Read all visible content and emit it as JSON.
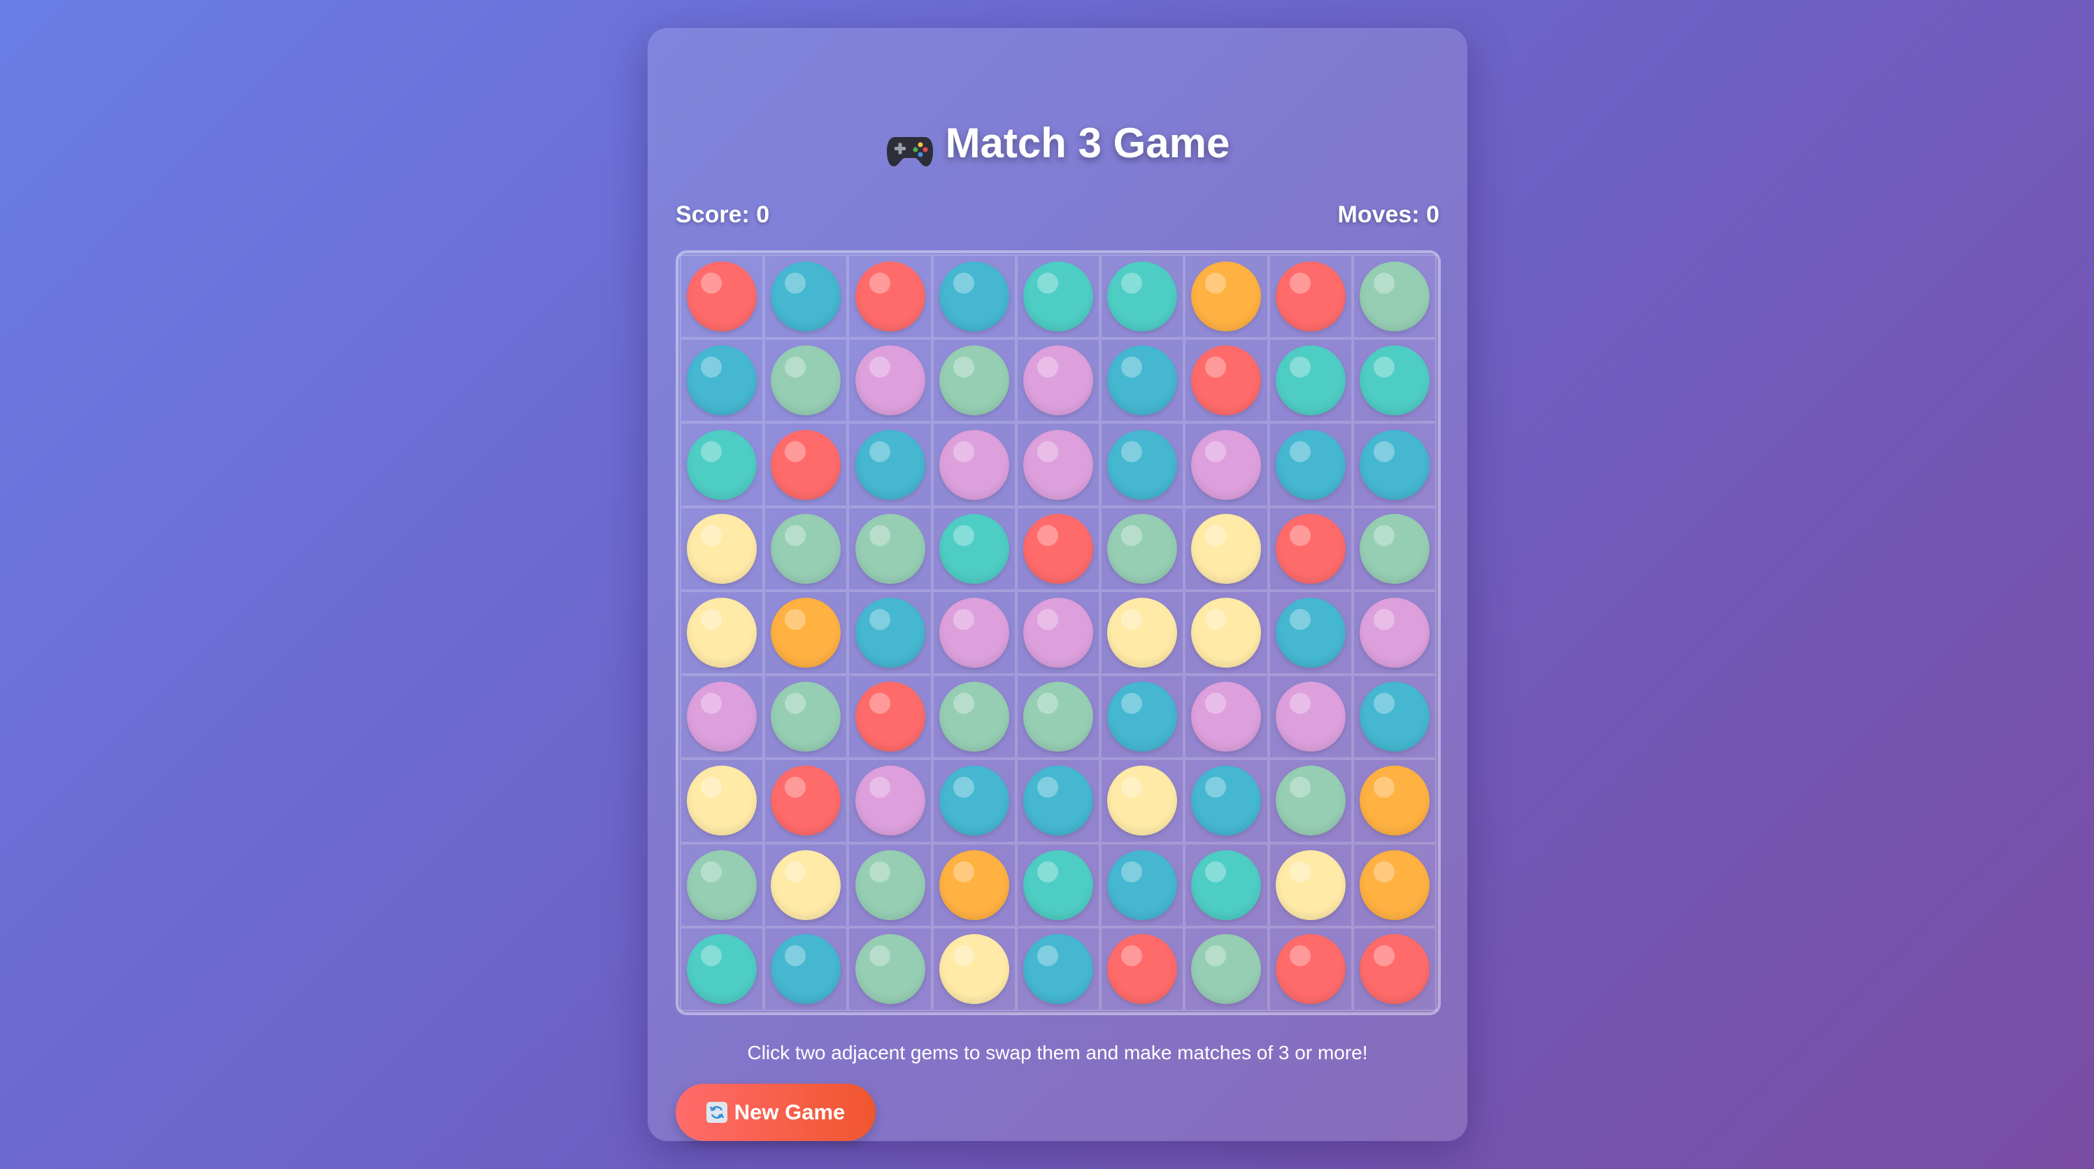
{
  "title": "Match 3 Game",
  "score_text": "Score: 0",
  "moves_text": "Moves: 0",
  "instructions": "Click two adjacent gems to swap them and make matches of 3 or more!",
  "new_game_label": "New Game",
  "icons": {
    "title": "gamepad-icon",
    "new_game": "refresh-icon"
  },
  "colors": {
    "R": "#ff6b6b",
    "B": "#45b7d1",
    "T": "#4ecdc4",
    "G": "#96ceb4",
    "P": "#dda0dd",
    "Y": "#ffeaa7",
    "O": "#ffb142"
  },
  "gem_names": {
    "R": "red",
    "B": "blue",
    "T": "teal",
    "G": "green",
    "P": "pink",
    "Y": "yellow",
    "O": "orange"
  },
  "board": [
    [
      "R",
      "B",
      "R",
      "B",
      "T",
      "T",
      "O",
      "R",
      "G"
    ],
    [
      "B",
      "G",
      "P",
      "G",
      "P",
      "B",
      "R",
      "T",
      "T"
    ],
    [
      "T",
      "R",
      "B",
      "P",
      "P",
      "B",
      "P",
      "B",
      "B"
    ],
    [
      "Y",
      "G",
      "G",
      "T",
      "R",
      "G",
      "Y",
      "R",
      "G"
    ],
    [
      "Y",
      "O",
      "B",
      "P",
      "P",
      "Y",
      "Y",
      "B",
      "P"
    ],
    [
      "P",
      "G",
      "R",
      "G",
      "G",
      "B",
      "P",
      "P",
      "B"
    ],
    [
      "Y",
      "R",
      "P",
      "B",
      "B",
      "Y",
      "B",
      "G",
      "O"
    ],
    [
      "G",
      "Y",
      "G",
      "O",
      "T",
      "B",
      "T",
      "Y",
      "O"
    ],
    [
      "T",
      "B",
      "G",
      "Y",
      "B",
      "R",
      "G",
      "R",
      "R"
    ]
  ]
}
